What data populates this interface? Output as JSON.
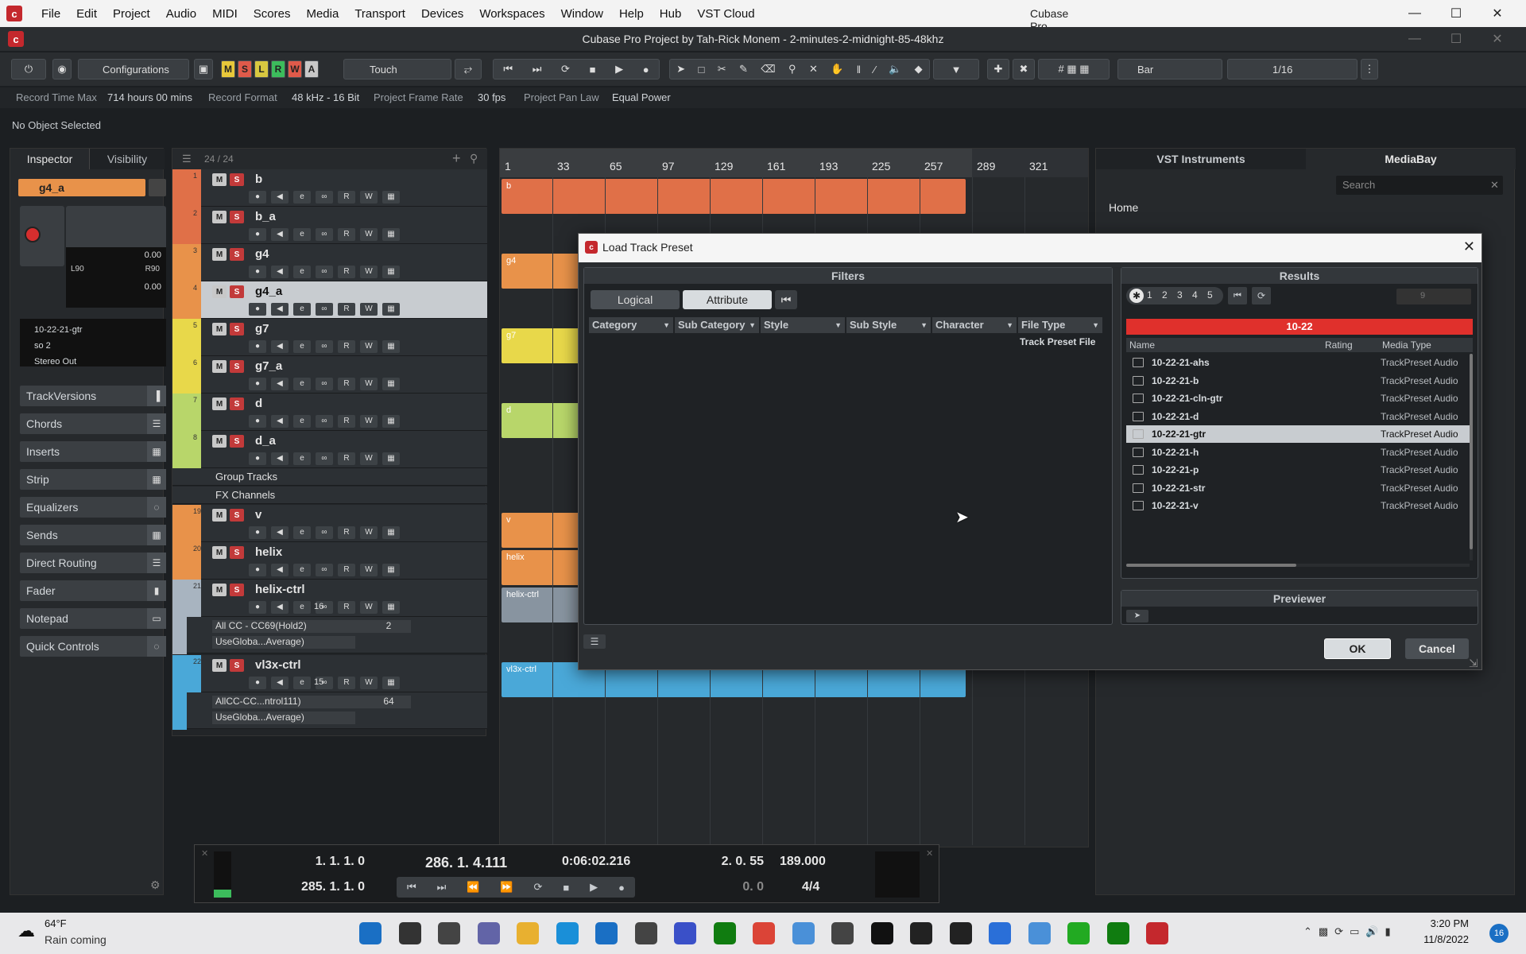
{
  "app": {
    "title": "Cubase Pro",
    "menus": [
      "File",
      "Edit",
      "Project",
      "Audio",
      "MIDI",
      "Scores",
      "Media",
      "Transport",
      "Devices",
      "Workspaces",
      "Window",
      "Help",
      "Hub",
      "VST Cloud"
    ]
  },
  "project": {
    "title": "Cubase Pro Project by Tah-Rick Monem - 2-minutes-2-midnight-85-48khz"
  },
  "toolbar": {
    "configurations": "Configurations",
    "mode_buttons": [
      "M",
      "S",
      "L",
      "R",
      "W",
      "A"
    ],
    "automation_mode": "Touch",
    "grid_type": "Bar",
    "quantize": "1/16"
  },
  "status": {
    "record_time_max_label": "Record Time Max",
    "record_time_max": "714 hours 00 mins",
    "record_format_label": "Record Format",
    "record_format": "48 kHz - 16 Bit",
    "frame_rate_label": "Project Frame Rate",
    "frame_rate": "30 fps",
    "pan_law_label": "Project Pan Law",
    "pan_law": "Equal Power"
  },
  "info_line": "No Object Selected",
  "inspector": {
    "tabs": [
      "Inspector",
      "Visibility"
    ],
    "track_name": "g4_a",
    "volume": "0.00",
    "pan_l": "L90",
    "pan_r": "R90",
    "pan_val": "0.00",
    "preset": "10-22-21-gtr",
    "input": "so 2",
    "output": "Stereo Out",
    "sections": [
      "TrackVersions",
      "Chords",
      "Inserts",
      "Strip",
      "Equalizers",
      "Sends",
      "Direct Routing",
      "Fader",
      "Notepad",
      "Quick Controls"
    ]
  },
  "tracklist": {
    "count": "24 / 24",
    "tracks": [
      {
        "num": "1",
        "name": "b",
        "color": "#e07048"
      },
      {
        "num": "2",
        "name": "b_a",
        "color": "#e07048"
      },
      {
        "num": "3",
        "name": "g4",
        "color": "#e8924a"
      },
      {
        "num": "4",
        "name": "g4_a",
        "color": "#e8924a"
      },
      {
        "num": "5",
        "name": "g7",
        "color": "#e8d84a"
      },
      {
        "num": "6",
        "name": "g7_a",
        "color": "#e8d84a"
      },
      {
        "num": "7",
        "name": "d",
        "color": "#b8d66a"
      },
      {
        "num": "8",
        "name": "d_a",
        "color": "#b8d66a"
      }
    ],
    "folders": [
      "Group Tracks",
      "FX Channels"
    ],
    "tracks2": [
      {
        "num": "19",
        "name": "v",
        "color": "#e8924a"
      },
      {
        "num": "20",
        "name": "helix",
        "color": "#e8924a"
      },
      {
        "num": "21",
        "name": "helix-ctrl",
        "color": "#a8b4c0"
      },
      {
        "num": "22",
        "name": "vl3x-ctrl",
        "color": "#4aa8d8"
      }
    ],
    "helix_ctrl_value": "16",
    "helix_cc_lane": "All CC - CC69(Hold2)",
    "helix_cc_lane_value": "2",
    "helix_cc_lane2": "UseGloba...Average)",
    "vl3x_ctrl_value": "15",
    "vl3x_cc_lane": "AllCC-CC...ntrol111)",
    "vl3x_cc_lane_value": "64",
    "vl3x_cc_lane2": "UseGloba...Average)"
  },
  "ruler": {
    "bars": [
      "1",
      "33",
      "65",
      "97",
      "129",
      "161",
      "193",
      "225",
      "257",
      "289",
      "321"
    ]
  },
  "parts": [
    "b",
    "g4",
    "g7",
    "d",
    "v",
    "helix",
    "helix-ctrl",
    "vl3x-ctrl"
  ],
  "right_zone": {
    "tabs": [
      "VST Instruments",
      "MediaBay"
    ],
    "search_placeholder": "Search",
    "home": "Home"
  },
  "dialog": {
    "title": "Load Track Preset",
    "filters_title": "Filters",
    "filter_tabs": [
      "Logical",
      "Attribute"
    ],
    "filter_columns": [
      "Category",
      "Sub Category",
      "Style",
      "Sub Style",
      "Character",
      "File Type"
    ],
    "file_type_value": "Track Preset File",
    "results_title": "Results",
    "rating_filters": [
      "1",
      "2",
      "3",
      "4",
      "5"
    ],
    "result_count": "9",
    "search_term": "10-22",
    "result_columns": [
      "Name",
      "Rating",
      "Media Type"
    ],
    "results": [
      {
        "name": "10-22-21-ahs",
        "type": "TrackPreset Audio"
      },
      {
        "name": "10-22-21-b",
        "type": "TrackPreset Audio"
      },
      {
        "name": "10-22-21-cln-gtr",
        "type": "TrackPreset Audio"
      },
      {
        "name": "10-22-21-d",
        "type": "TrackPreset Audio"
      },
      {
        "name": "10-22-21-gtr",
        "type": "TrackPreset Audio",
        "selected": true
      },
      {
        "name": "10-22-21-h",
        "type": "TrackPreset Audio"
      },
      {
        "name": "10-22-21-p",
        "type": "TrackPreset Audio"
      },
      {
        "name": "10-22-21-str",
        "type": "TrackPreset Audio"
      },
      {
        "name": "10-22-21-v",
        "type": "TrackPreset Audio"
      }
    ],
    "previewer_title": "Previewer",
    "ok": "OK",
    "cancel": "Cancel"
  },
  "transport": {
    "left_locator": "1. 1. 1.   0",
    "right_locator": "285. 1. 1.   0",
    "position_bars": "286. 1. 4.111",
    "position_time": "0:06:02.216",
    "punch_val": "2. 0. 55",
    "punch_val2": "0.   0",
    "tempo": "189.000",
    "signature": "4/4"
  },
  "taskbar": {
    "weather_temp": "64°F",
    "weather_desc": "Rain coming",
    "time": "3:20 PM",
    "date": "11/8/2022",
    "notif": "16"
  }
}
